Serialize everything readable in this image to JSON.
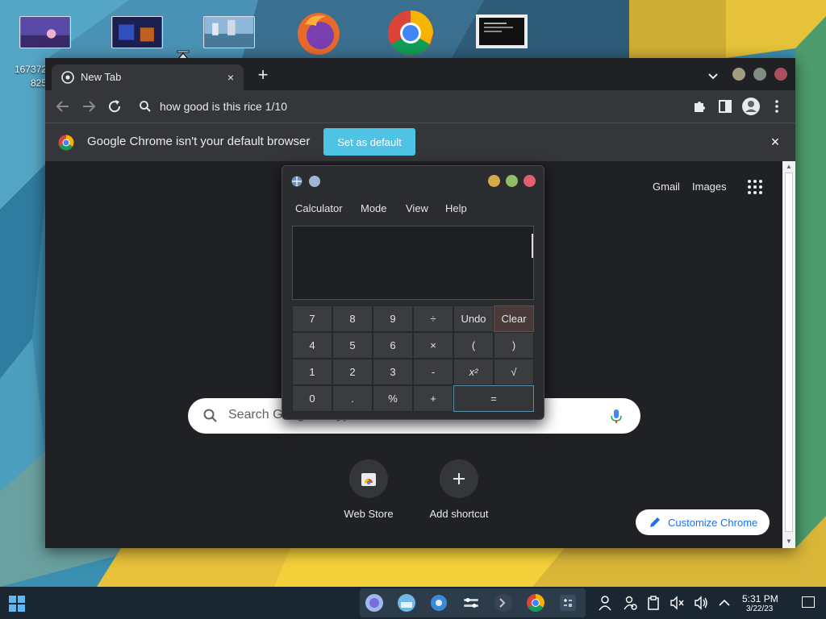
{
  "desktop": {
    "file_label_line1": "167372",
    "file_label_line2": "825"
  },
  "chrome": {
    "tab_title": "New Tab",
    "tab_close": "×",
    "new_tab": "+",
    "omnibox_text": "how good is this rice 1/10",
    "infobar_text": "Google Chrome isn't your default browser",
    "set_default_label": "Set as default",
    "infobar_close": "×",
    "gmail": "Gmail",
    "images": "Images",
    "search_placeholder": "Search Google or type a URL",
    "shortcuts": [
      {
        "label": "Web Store"
      },
      {
        "label": "Add shortcut"
      }
    ],
    "customize_label": "Customize Chrome",
    "accent": "#4fc3e6"
  },
  "calculator": {
    "menus": [
      "Calculator",
      "Mode",
      "View",
      "Help"
    ],
    "keys": {
      "k7": "7",
      "k8": "8",
      "k9": "9",
      "div": "÷",
      "undo": "Undo",
      "clear": "Clear",
      "k4": "4",
      "k5": "5",
      "k6": "6",
      "mul": "×",
      "lparen": "(",
      "rparen": ")",
      "k1": "1",
      "k2": "2",
      "k3": "3",
      "sub": "-",
      "sq": "x²",
      "sqrt": "√",
      "k0": "0",
      "dot": ".",
      "pct": "%",
      "add": "+",
      "eq": "="
    }
  },
  "taskbar": {
    "time": "5:31 PM",
    "date": "3/22/23"
  }
}
